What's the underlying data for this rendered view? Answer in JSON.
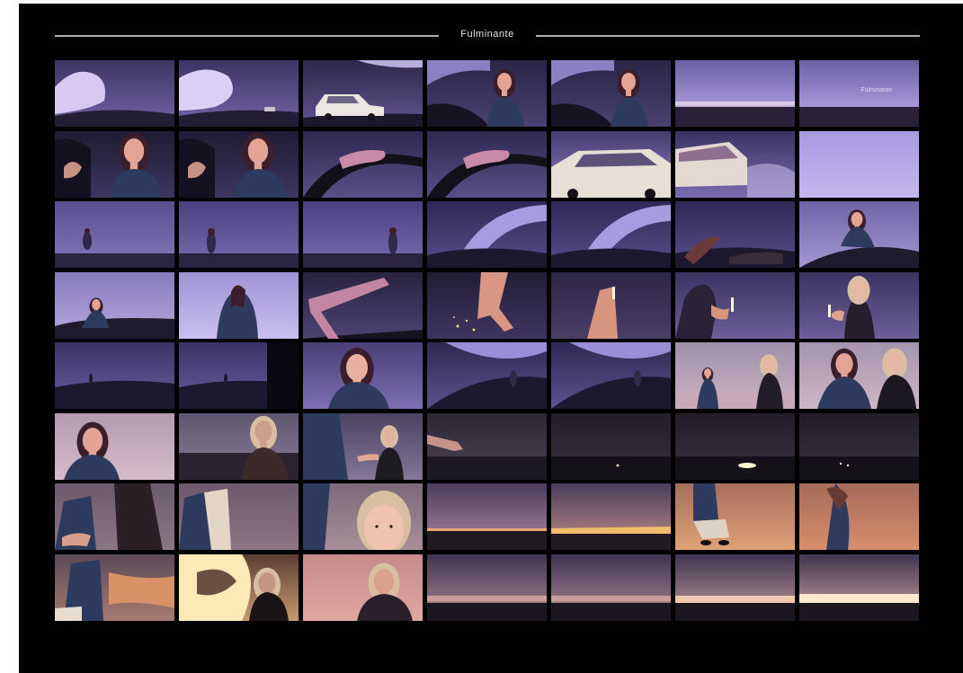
{
  "title": "Fulminante",
  "frames": [
    {
      "id": 1,
      "scene": "storm-cloud",
      "caption": ""
    },
    {
      "id": 2,
      "scene": "storm-cloud-distant",
      "caption": ""
    },
    {
      "id": 3,
      "scene": "car-in-storm",
      "caption": ""
    },
    {
      "id": 4,
      "scene": "woman-driving",
      "caption": ""
    },
    {
      "id": 5,
      "scene": "woman-driving",
      "caption": ""
    },
    {
      "id": 6,
      "scene": "horizon-glow",
      "caption": ""
    },
    {
      "id": 7,
      "scene": "horizon-glow-title",
      "caption": "Fulminante"
    },
    {
      "id": 8,
      "scene": "woman-driving-close",
      "caption": ""
    },
    {
      "id": 9,
      "scene": "woman-driving-close",
      "caption": ""
    },
    {
      "id": 10,
      "scene": "hand-on-wheel",
      "caption": ""
    },
    {
      "id": 11,
      "scene": "hand-on-wheel",
      "caption": ""
    },
    {
      "id": 12,
      "scene": "car-closeup",
      "caption": ""
    },
    {
      "id": 13,
      "scene": "car-closeup-rear",
      "caption": ""
    },
    {
      "id": 14,
      "scene": "sky-plain",
      "caption": ""
    },
    {
      "id": 15,
      "scene": "sky-lavender",
      "caption": ""
    },
    {
      "id": 16,
      "scene": "figure-distant",
      "caption": ""
    },
    {
      "id": 17,
      "scene": "figure-distant-right",
      "caption": ""
    },
    {
      "id": 18,
      "scene": "cloud-arc",
      "caption": ""
    },
    {
      "id": 19,
      "scene": "cloud-arc",
      "caption": ""
    },
    {
      "id": 20,
      "scene": "hair-wind",
      "caption": ""
    },
    {
      "id": 21,
      "scene": "woman-hill",
      "caption": ""
    },
    {
      "id": 22,
      "scene": "woman-hill-left",
      "caption": ""
    },
    {
      "id": 23,
      "scene": "woman-back",
      "caption": ""
    },
    {
      "id": 24,
      "scene": "arm-reach",
      "caption": ""
    },
    {
      "id": 25,
      "scene": "hand-sparks",
      "caption": ""
    },
    {
      "id": 26,
      "scene": "hand-light",
      "caption": ""
    },
    {
      "id": 27,
      "scene": "woman-shoulder-light",
      "caption": ""
    },
    {
      "id": 28,
      "scene": "blonde-woman-light",
      "caption": ""
    },
    {
      "id": 29,
      "scene": "dark-hill",
      "caption": ""
    },
    {
      "id": 30,
      "scene": "dark-hill-door",
      "caption": ""
    },
    {
      "id": 31,
      "scene": "woman-portrait",
      "caption": ""
    },
    {
      "id": 32,
      "scene": "figure-hill-cloud",
      "caption": ""
    },
    {
      "id": 33,
      "scene": "figure-hill-cloud",
      "caption": ""
    },
    {
      "id": 34,
      "scene": "two-women-far",
      "caption": ""
    },
    {
      "id": 35,
      "scene": "two-women-near",
      "caption": ""
    },
    {
      "id": 36,
      "scene": "woman-portrait-pink",
      "caption": ""
    },
    {
      "id": 37,
      "scene": "blonde-back",
      "caption": ""
    },
    {
      "id": 38,
      "scene": "two-women-reach",
      "caption": ""
    },
    {
      "id": 39,
      "scene": "arm-dark",
      "caption": ""
    },
    {
      "id": 40,
      "scene": "dark-ground",
      "caption": ""
    },
    {
      "id": 41,
      "scene": "dark-ground-spark",
      "caption": ""
    },
    {
      "id": 42,
      "scene": "dark-ground-lights",
      "caption": ""
    },
    {
      "id": 43,
      "scene": "body-close",
      "caption": ""
    },
    {
      "id": 44,
      "scene": "body-close-left",
      "caption": ""
    },
    {
      "id": 45,
      "scene": "blonde-face",
      "caption": ""
    },
    {
      "id": 46,
      "scene": "horizon-fire",
      "caption": ""
    },
    {
      "id": 47,
      "scene": "horizon-fire-bright",
      "caption": ""
    },
    {
      "id": 48,
      "scene": "woman-sitting-fire",
      "caption": ""
    },
    {
      "id": 49,
      "scene": "woman-fire-smoke",
      "caption": ""
    },
    {
      "id": 50,
      "scene": "fire-figure",
      "caption": ""
    },
    {
      "id": 51,
      "scene": "fire-smoke-blonde",
      "caption": ""
    },
    {
      "id": 52,
      "scene": "blonde-pink",
      "caption": ""
    },
    {
      "id": 53,
      "scene": "horizon-dusk",
      "caption": ""
    },
    {
      "id": 54,
      "scene": "horizon-dusk",
      "caption": ""
    },
    {
      "id": 55,
      "scene": "horizon-dusk-glow",
      "caption": ""
    },
    {
      "id": 56,
      "scene": "horizon-dusk-bright",
      "caption": ""
    }
  ],
  "colors": {
    "background": "#010101",
    "rule": "#cfcfcf",
    "lavender": "#8a7fc2",
    "deep_violet": "#3b3360",
    "skin": "#e5a592",
    "hair_dark": "#3a2030",
    "blonde": "#d8c0a8",
    "fire": "#f0a060"
  }
}
